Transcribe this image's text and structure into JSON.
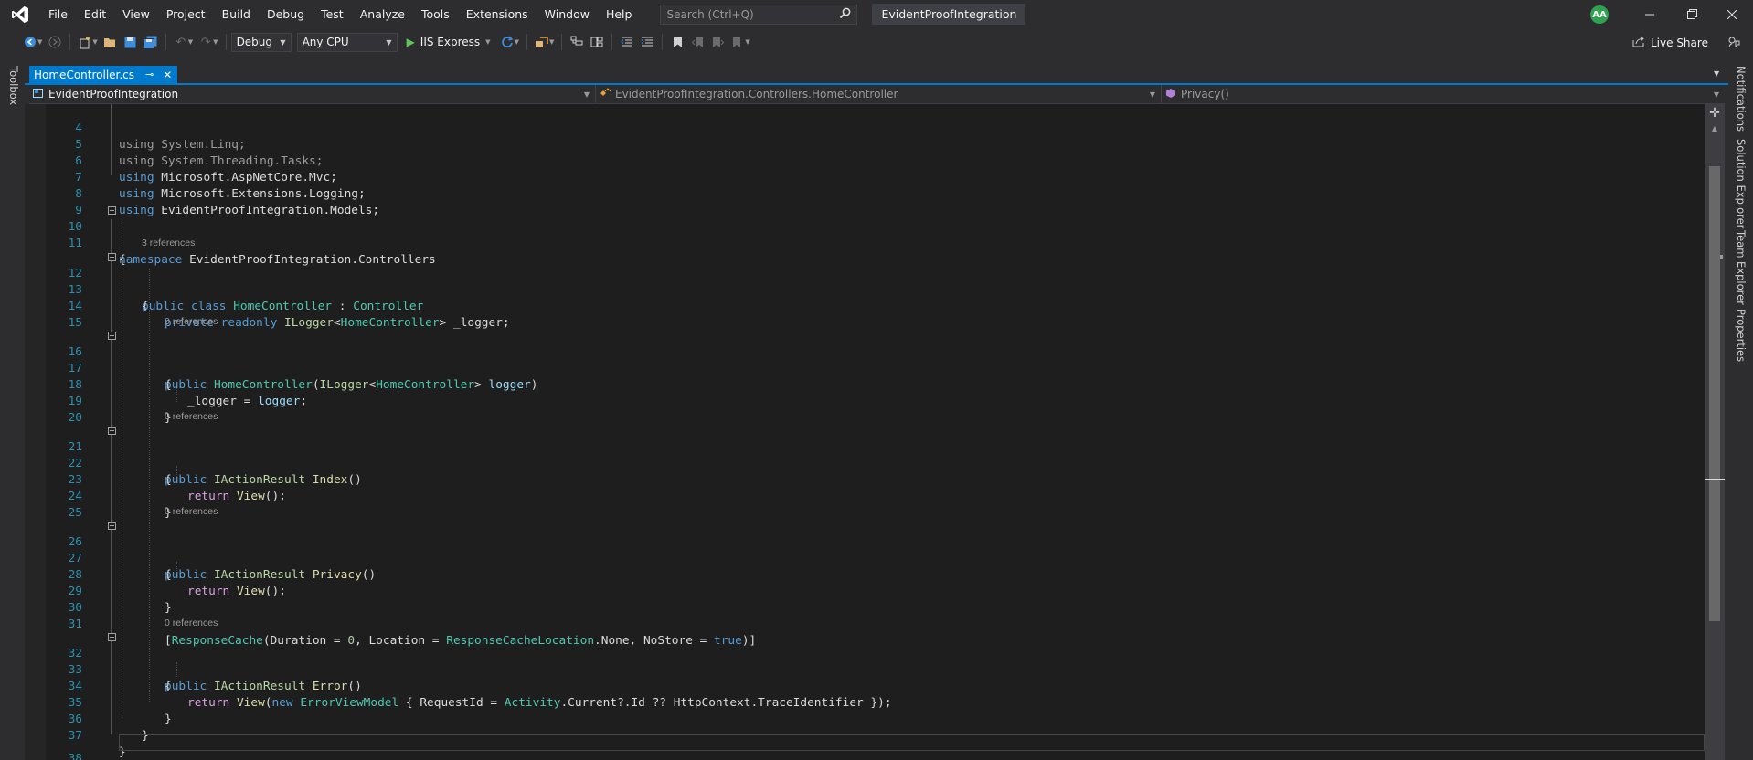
{
  "menu": [
    "File",
    "Edit",
    "View",
    "Project",
    "Build",
    "Debug",
    "Test",
    "Analyze",
    "Tools",
    "Extensions",
    "Window",
    "Help"
  ],
  "search": {
    "placeholder": "Search (Ctrl+Q)"
  },
  "solution_title": "EvidentProofIntegration",
  "user_initials": "AA",
  "toolbar": {
    "configuration": "Debug",
    "platform": "Any CPU",
    "run_target": "IIS Express",
    "live_share": "Live Share"
  },
  "left_tools": [
    "Toolbox"
  ],
  "right_tools": [
    "Notifications",
    "Solution Explorer",
    "Team Explorer",
    "Properties"
  ],
  "document_tab": {
    "label": "HomeController.cs"
  },
  "navbar": {
    "project": "EvidentProofIntegration",
    "type": "EvidentProofIntegration.Controllers.HomeController",
    "member": "Privacy()"
  },
  "codelens": {
    "class_refs": "3 references",
    "ctor_refs": "0 references",
    "index_refs": "0 references",
    "privacy_refs": "0 references",
    "error_refs": "0 references"
  },
  "line_numbers": [
    "4",
    "5",
    "6",
    "7",
    "8",
    "9",
    "10",
    "11",
    "12",
    "13",
    "14",
    "15",
    "16",
    "17",
    "18",
    "19",
    "20",
    "21",
    "22",
    "23",
    "24",
    "25",
    "26",
    "27",
    "28",
    "29",
    "30",
    "31",
    "32",
    "33",
    "34",
    "35",
    "36",
    "37",
    "38"
  ],
  "code": {
    "l4": [
      "using",
      "System.Linq;"
    ],
    "l5": [
      "using",
      "System.Threading.Tasks;"
    ],
    "l6": [
      "using",
      "Microsoft.AspNetCore.Mvc;"
    ],
    "l7": [
      "using",
      "Microsoft.Extensions.Logging;"
    ],
    "l8": [
      "using",
      "EvidentProofIntegration.Models;"
    ],
    "l10": [
      "namespace",
      "EvidentProofIntegration.Controllers"
    ],
    "l12": [
      "public",
      "class",
      "HomeController",
      ":",
      "Controller"
    ],
    "l14": [
      "private",
      "readonly",
      "ILogger",
      "<",
      "HomeController",
      ">",
      "_logger;"
    ],
    "l16": [
      "public",
      "HomeController",
      "(",
      "ILogger",
      "<",
      "HomeController",
      ">",
      "logger",
      ")"
    ],
    "l18": [
      "_logger",
      "=",
      "logger",
      ";"
    ],
    "l21": [
      "public",
      "IActionResult",
      "Index",
      "()"
    ],
    "l23": [
      "return",
      "View",
      "();"
    ],
    "l26": [
      "public",
      "IActionResult",
      "Privacy",
      "()"
    ],
    "l28": [
      "return",
      "View",
      "();"
    ],
    "l31": [
      "[",
      "ResponseCache",
      "(Duration = ",
      "0",
      ", Location = ",
      "ResponseCacheLocation",
      ".None, NoStore = ",
      "true",
      ")]"
    ],
    "l32": [
      "public",
      "IActionResult",
      "Error",
      "()"
    ],
    "l34": [
      "return",
      "View",
      "(",
      "new",
      "ErrorViewModel",
      " { RequestId = ",
      "Activity",
      ".Current?.Id ?? HttpContext.TraceIdentifier });"
    ],
    "open_brace": "{",
    "close_brace": "}"
  },
  "colors": {
    "accent": "#007acc",
    "editor_bg": "#1e1e1e",
    "chrome_bg": "#2d2d30",
    "keyword": "#569cd6",
    "control_keyword": "#d8a0df",
    "type": "#4ec9b0",
    "method": "#dcdcaa",
    "parameter": "#9cdcfe",
    "line_number": "#2b91af"
  }
}
